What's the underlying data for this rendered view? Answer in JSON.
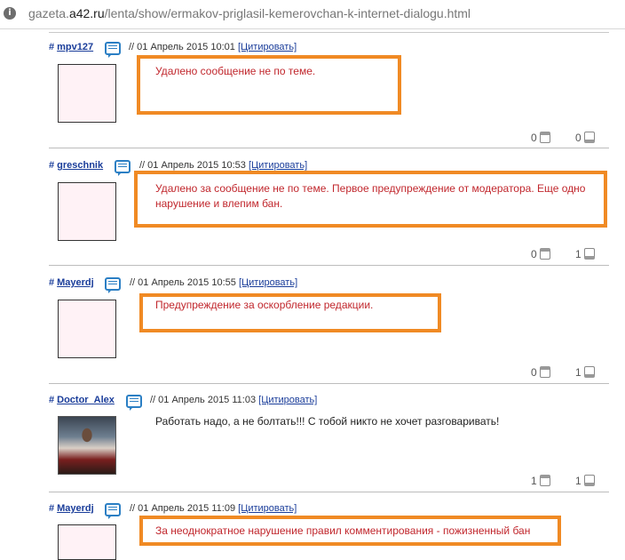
{
  "browser": {
    "url_prefix": "gazeta.",
    "url_domain": "a42.ru",
    "url_path": "/lenta/show/ermakov-priglasil-kemerovchan-k-internet-dialogu.html"
  },
  "comments": [
    {
      "hash": "#",
      "author": "mpv127",
      "date": "// 01 Апрель 2015 10:01",
      "quote_label": "[Цитировать]",
      "text": "Удалено сообщение не по теме.",
      "votes_down": "0",
      "votes_up": "0",
      "highlighted": true
    },
    {
      "hash": "#",
      "author": "greschnik",
      "date": "// 01 Апрель 2015 10:53",
      "quote_label": "[Цитировать]",
      "text": "Удалено за сообщение не по теме. Первое предупреждение от модератора. Еще одно нарушение и влепим бан.",
      "votes_down": "0",
      "votes_up": "1",
      "highlighted": true
    },
    {
      "hash": "#",
      "author": "Mayerdj",
      "date": "// 01 Апрель 2015 10:55",
      "quote_label": "[Цитировать]",
      "text": "Предупреждение за оскорбление редакции.",
      "votes_down": "0",
      "votes_up": "1",
      "highlighted": true
    },
    {
      "hash": "#",
      "author": "Doctor_Alex",
      "date": "// 01 Апрель 2015 11:03",
      "quote_label": "[Цитировать]",
      "text": "Работать надо, а не болтать!!! С тобой никто не хочет разговаривать!",
      "votes_down": "1",
      "votes_up": "1",
      "highlighted": false
    },
    {
      "hash": "#",
      "author": "Mayerdj",
      "date": "// 01 Апрель 2015 11:09",
      "quote_label": "[Цитировать]",
      "text": "За неоднократное нарушение правил комментирования - пожизненный бан",
      "highlighted": true
    }
  ],
  "colors": {
    "moderator_text": "#c1272d",
    "highlight_frame": "#f08a24",
    "link": "#1a3d9a"
  }
}
